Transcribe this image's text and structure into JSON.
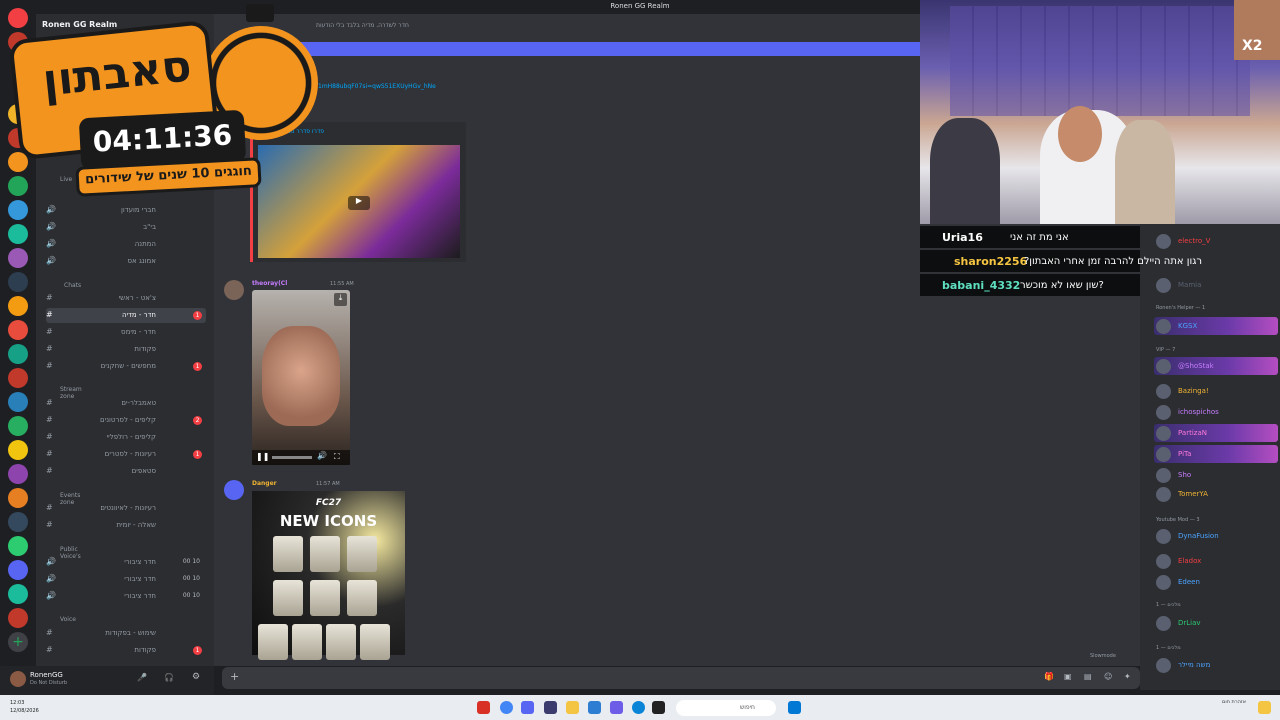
{
  "window": {
    "title": "Ronen GG Realm"
  },
  "server_name": "Ronen GG Realm",
  "overlay": {
    "title": "סאבתון",
    "timer": "04:11:36",
    "subtitle": "חוגגים 10 שנים של שידורים",
    "multiplier": "X2"
  },
  "channel_header": {
    "topic": "חדר לשדרה. מדיה בלבד בלי הודעות"
  },
  "sidebar": {
    "categories": [
      "Live",
      "Chats",
      "Stream zone",
      "Events zone",
      "Public Voice's",
      "Voice"
    ],
    "channels": [
      {
        "label": "חברי מועדון"
      },
      {
        "label": "בי\"ב"
      },
      {
        "label": "המתנה"
      },
      {
        "label": "אמונג אס"
      },
      {
        "label": "צ'אט - ראשי"
      },
      {
        "label": "חדר - מדיה",
        "unread": "1"
      },
      {
        "label": "חדר - מימס"
      },
      {
        "label": "פקודות"
      },
      {
        "label": "מחפשים - שחקנים",
        "unread": "1"
      },
      {
        "label": "טאמבלר-ים"
      },
      {
        "label": "קליפים - לסרטונים",
        "unread": "2"
      },
      {
        "label": "קליפים - רולפליי"
      },
      {
        "label": "רעיונות - לסטרים",
        "unread": "1"
      },
      {
        "label": "סטאפים"
      },
      {
        "label": "רעיונות - לאיוונטים"
      },
      {
        "label": "שאלה - יומית"
      },
      {
        "label": "חדר ציבורי",
        "count": "00 10"
      },
      {
        "label": "חדר ציבורי",
        "count": "00 10"
      },
      {
        "label": "חדר ציבורי",
        "count": "00 10"
      },
      {
        "label": "שימוש - בפקודות"
      },
      {
        "label": "פקודות",
        "unread": "1"
      }
    ]
  },
  "messages": {
    "link": "1mH88ubqF07si=qwS51EXUyHGv_hNe",
    "embed_title": "פדרו פדרר מגיב למקרה",
    "msg1": {
      "author": "theoray(Cl",
      "time": "11:55 AM"
    },
    "msg2": {
      "author": "Danger",
      "time": "11:57 AM",
      "image_title1": "FC27",
      "image_title2": "NEW ICONS"
    }
  },
  "slowmode": "Slowmode",
  "stream_chat": [
    {
      "user": "Uria16",
      "text": "אני מת זה אני",
      "color": "#ffffff"
    },
    {
      "user": "sharon2256",
      "text": "רגון אתה היילם להרבה זמן אחרי האבתון?",
      "color": "#f5c542"
    },
    {
      "user": "babani_4332",
      "text": "?שון שאו לא מוכשר",
      "color": "#5ee0c0"
    }
  ],
  "members": {
    "top": [
      {
        "name": "electro_V"
      },
      {
        "name": "Mamia"
      }
    ],
    "groups": [
      {
        "title": "Ronen's Helper — 1",
        "members": [
          {
            "name": "KGSX",
            "highlight": true
          }
        ]
      },
      {
        "title": "VIP — 7",
        "members": [
          {
            "name": "@ShoStak",
            "highlight": true
          },
          {
            "name": "Bazinga!"
          },
          {
            "name": "ichospichos"
          },
          {
            "name": "PartizaN",
            "highlight": true
          },
          {
            "name": "PiTa",
            "highlight": true
          },
          {
            "name": "Sho"
          },
          {
            "name": "TomerYA"
          }
        ]
      },
      {
        "title": "Youtube Mod — 3",
        "members": [
          {
            "name": "DynaFusion"
          },
          {
            "name": "Eladox"
          },
          {
            "name": "Edeen"
          }
        ]
      },
      {
        "title": "מלכים — 1",
        "members": [
          {
            "name": "DrLiav"
          }
        ]
      },
      {
        "title": "מלכים — 1",
        "members": [
          {
            "name": "משה מיילר"
          }
        ]
      }
    ]
  },
  "user": {
    "name": "RonenGG",
    "status": "Do Not Disturb"
  },
  "taskbar": {
    "time": "12:03",
    "date": "12/08/2026",
    "search": "חיפוש",
    "notif": "אזהרת חום"
  }
}
